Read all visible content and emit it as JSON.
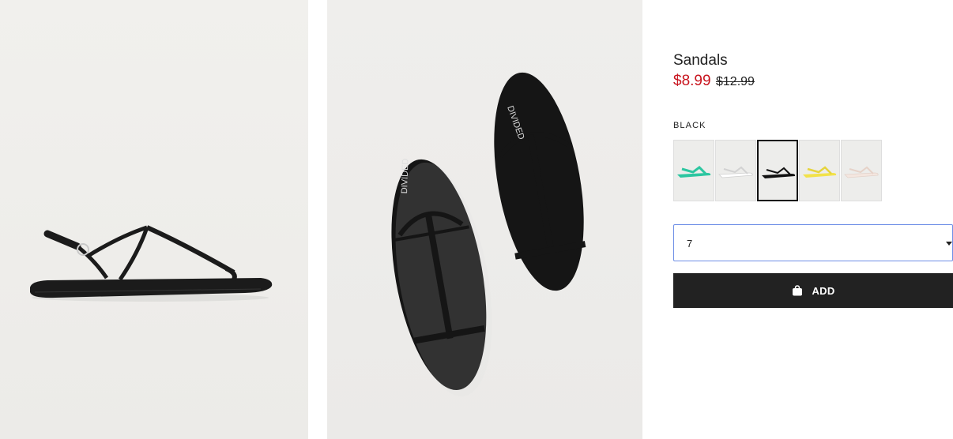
{
  "product": {
    "title": "Sandals",
    "sale_price": "$8.99",
    "original_price": "$12.99",
    "selected_color": "BLACK"
  },
  "gallery": {
    "images": [
      {
        "name": "side-view-photo",
        "icon": "sandal-side-view"
      },
      {
        "name": "top-view-photo",
        "icon": "sandal-pair-top-view"
      }
    ],
    "insole_print": "DIVIDED"
  },
  "swatches": [
    {
      "color": "#2cc6a0",
      "selected": false
    },
    {
      "color": "#ffffff",
      "selected": false
    },
    {
      "color": "#111111",
      "selected": true
    },
    {
      "color": "#f2e24a",
      "selected": false
    },
    {
      "color": "#f4e6df",
      "selected": false
    }
  ],
  "size_select": {
    "value": "7"
  },
  "add_button": {
    "label": "ADD",
    "icon": "shopping-bag-icon"
  },
  "colors": {
    "sale": "#c8141e",
    "button_bg": "#222222",
    "focus_border": "#6d8ee6"
  }
}
